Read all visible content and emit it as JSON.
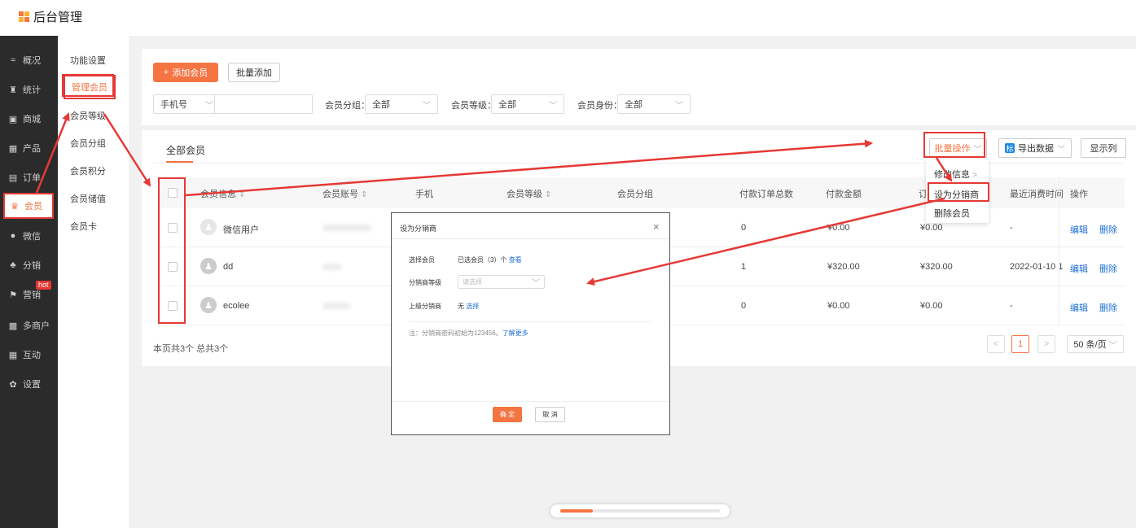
{
  "app": {
    "title": "后台管理",
    "logo_colors": [
      "#f47442",
      "#f9b233",
      "#f9b233",
      "#f47442"
    ]
  },
  "sidebar": {
    "items": [
      {
        "label": "概况",
        "icon": "≈"
      },
      {
        "label": "统计",
        "icon": "♜"
      },
      {
        "label": "商城",
        "icon": "▣"
      },
      {
        "label": "产品",
        "icon": "▦"
      },
      {
        "label": "订单",
        "icon": "▤"
      },
      {
        "label": "会员",
        "icon": "♛"
      },
      {
        "label": "微信",
        "icon": "●"
      },
      {
        "label": "分销",
        "icon": "♣"
      },
      {
        "label": "营销",
        "icon": "⚑"
      },
      {
        "label": "多商户",
        "icon": "▩"
      },
      {
        "label": "互动",
        "icon": "▦"
      },
      {
        "label": "设置",
        "icon": "✿"
      }
    ],
    "hot_badge": "hot"
  },
  "subnav": {
    "items": [
      "功能设置",
      "管理会员",
      "会员等级",
      "会员分组",
      "会员积分",
      "会员储值",
      "会员卡"
    ]
  },
  "toolbar": {
    "add_label": "添加会员",
    "add_icon": "+",
    "batch_add_label": "批量添加"
  },
  "filters": {
    "phone_label": "手机号",
    "group_label": "会员分组：",
    "group_value": "全部",
    "level_label": "会员等级：",
    "level_value": "全部",
    "identity_label": "会员身份：",
    "identity_value": "全部"
  },
  "list": {
    "tab_all": "全部会员",
    "bulk_label": "批量操作",
    "export_icon": "标",
    "export_label": "导出数据",
    "columns_label": "显示列",
    "headers": [
      "会员信息",
      "会员账号",
      "手机",
      "会员等级",
      "会员分组",
      "付款订单总数",
      "付款金额",
      "订",
      "最近消费时间",
      "操作"
    ],
    "sort_icon": "⇕",
    "rows": [
      {
        "name": "微信用户",
        "orders": "0",
        "amount": "¥0.00",
        "amount2": "¥0.00",
        "last": "-",
        "edit": "编辑",
        "delete": "删除"
      },
      {
        "name": "dd",
        "orders": "1",
        "amount": "¥320.00",
        "amount2": "¥320.00",
        "last": "2022-01-10 1",
        "edit": "编辑",
        "delete": "删除"
      },
      {
        "name": "ecolee",
        "orders": "0",
        "amount": "¥0.00",
        "amount2": "¥0.00",
        "last": "-",
        "edit": "编辑",
        "delete": "删除"
      }
    ],
    "footer": "本页共3个 总共3个",
    "current_page": "1",
    "page_size": "50 条/页"
  },
  "dropdown": {
    "items": [
      "修改信息",
      "设为分销商",
      "删除会员"
    ]
  },
  "modal": {
    "title": "设为分销商",
    "close": "×",
    "select_member_label": "选择会员",
    "select_member_value": "已选会员（3）个",
    "view_link": "查看",
    "level_label": "分销商等级",
    "level_placeholder": "请选择",
    "parent_label": "上级分销商",
    "parent_value": "无",
    "choose_link": "选择",
    "note": "注：分销商密码初始为123456。",
    "learn_more": "了解更多",
    "ok": "确 定",
    "cancel": "取 消"
  },
  "colors": {
    "accent": "#f47442",
    "annotation": "#e53935",
    "link": "#1e6fd9"
  }
}
